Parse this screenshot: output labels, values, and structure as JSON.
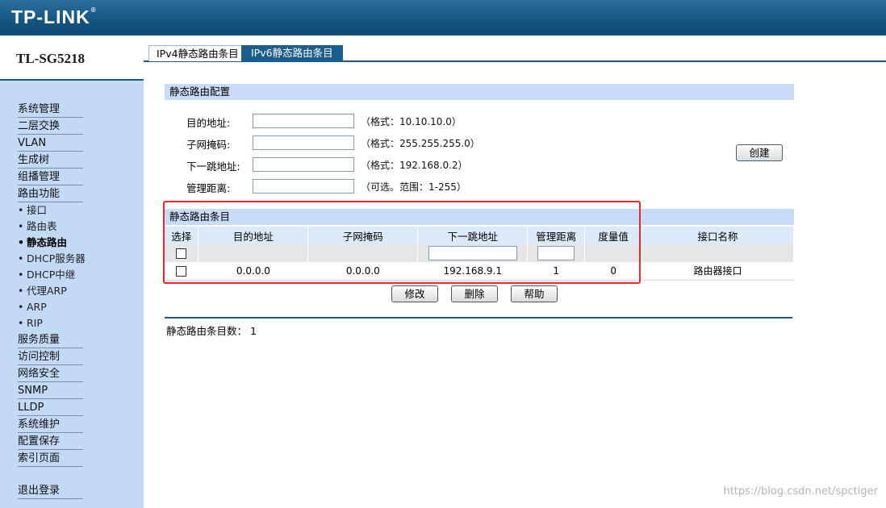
{
  "header": {
    "logo": "TP-LINK",
    "logo_mark": "®"
  },
  "sidebar": {
    "model": "TL-SG5218",
    "items": [
      {
        "label": "系统管理"
      },
      {
        "label": "二层交换"
      },
      {
        "label": "VLAN"
      },
      {
        "label": "生成树"
      },
      {
        "label": "组播管理"
      },
      {
        "label": "路由功能"
      }
    ],
    "sub_items": [
      {
        "label": "接口"
      },
      {
        "label": "路由表"
      },
      {
        "label": "静态路由"
      },
      {
        "label": "DHCP服务器"
      },
      {
        "label": "DHCP中继"
      },
      {
        "label": "代理ARP"
      },
      {
        "label": "ARP"
      },
      {
        "label": "RIP"
      }
    ],
    "items_after": [
      {
        "label": "服务质量"
      },
      {
        "label": "访问控制"
      },
      {
        "label": "网络安全"
      },
      {
        "label": "SNMP"
      },
      {
        "label": "LLDP"
      },
      {
        "label": "系统维护"
      },
      {
        "label": "配置保存"
      },
      {
        "label": "索引页面"
      }
    ],
    "logout": "退出登录",
    "bullet": "•"
  },
  "tabs": [
    {
      "label": "IPv4静态路由条目"
    },
    {
      "label": "IPv6静态路由条目"
    }
  ],
  "config": {
    "title": "静态路由配置",
    "fields": [
      {
        "label": "目的地址:",
        "value": "",
        "hint": "（格式：10.10.10.0）"
      },
      {
        "label": "子网掩码:",
        "value": "",
        "hint": "（格式：255.255.255.0）"
      },
      {
        "label": "下一跳地址:",
        "value": "",
        "hint": "（格式：192.168.0.2）"
      },
      {
        "label": "管理距离:",
        "value": "",
        "hint": "（可选。范围：1-255）"
      }
    ],
    "create_button": "创建"
  },
  "entries": {
    "title": "静态路由条目",
    "columns": [
      "选择",
      "目的地址",
      "子网掩码",
      "下一跳地址",
      "管理距离",
      "度量值",
      "接口名称"
    ],
    "rows": [
      {
        "dest": "0.0.0.0",
        "mask": "0.0.0.0",
        "next_hop": "192.168.9.1",
        "distance": "1",
        "metric": "0",
        "interface": "路由器接口"
      }
    ],
    "buttons": {
      "modify": "修改",
      "delete": "删除",
      "help": "帮助"
    },
    "count_label": "静态路由条目数：",
    "count": "1"
  },
  "watermark": "https://blog.csdn.net/spctiger",
  "colors": {
    "header": "#13547f",
    "sidebar": "#c3daf7",
    "section": "#c8dcf7",
    "highlight": "#e8282b"
  }
}
